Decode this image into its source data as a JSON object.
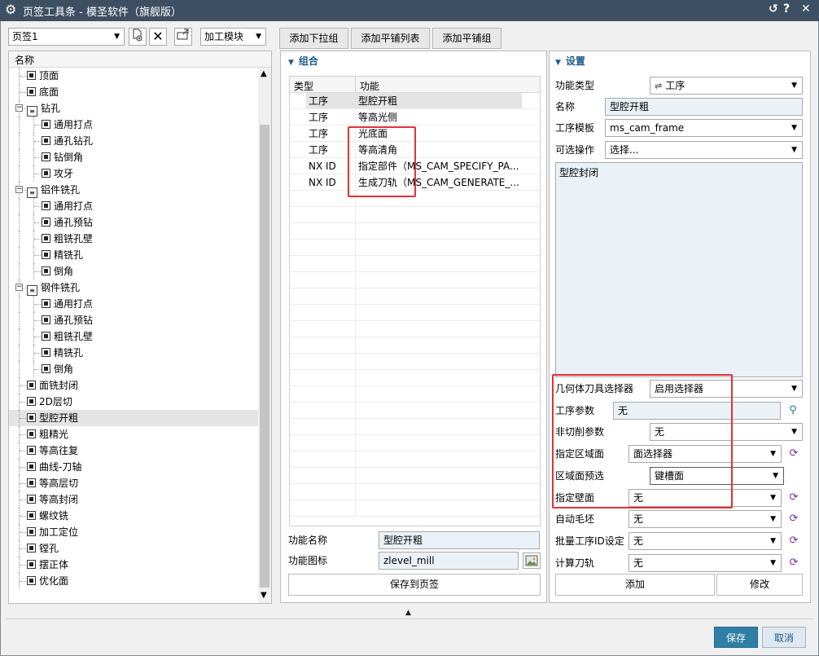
{
  "window": {
    "title": "页签工具条 - 模圣软件（旗舰版）",
    "reset_glyph": "↺",
    "help_glyph": "?",
    "close_glyph": "✕"
  },
  "left": {
    "page_select": "页签1",
    "module_select": "加工模块",
    "column_header": "名称",
    "tree": [
      {
        "label": "顶面",
        "level": 1,
        "type": "leaf"
      },
      {
        "label": "底面",
        "level": 1,
        "type": "leaf"
      },
      {
        "label": "钻孔",
        "level": 1,
        "type": "group"
      },
      {
        "label": "通用打点",
        "level": 2,
        "type": "leaf"
      },
      {
        "label": "通孔钻孔",
        "level": 2,
        "type": "leaf"
      },
      {
        "label": "钻倒角",
        "level": 2,
        "type": "leaf"
      },
      {
        "label": "攻牙",
        "level": 2,
        "type": "leaf"
      },
      {
        "label": "铝件铣孔",
        "level": 1,
        "type": "group"
      },
      {
        "label": "通用打点",
        "level": 2,
        "type": "leaf"
      },
      {
        "label": "通孔预钻",
        "level": 2,
        "type": "leaf"
      },
      {
        "label": "粗铣孔壁",
        "level": 2,
        "type": "leaf"
      },
      {
        "label": "精铣孔",
        "level": 2,
        "type": "leaf"
      },
      {
        "label": "倒角",
        "level": 2,
        "type": "leaf"
      },
      {
        "label": "钢件铣孔",
        "level": 1,
        "type": "group"
      },
      {
        "label": "通用打点",
        "level": 2,
        "type": "leaf"
      },
      {
        "label": "通孔预钻",
        "level": 2,
        "type": "leaf"
      },
      {
        "label": "粗铣孔壁",
        "level": 2,
        "type": "leaf"
      },
      {
        "label": "精铣孔",
        "level": 2,
        "type": "leaf"
      },
      {
        "label": "倒角",
        "level": 2,
        "type": "leaf"
      },
      {
        "label": "面铣封闭",
        "level": 1,
        "type": "leaf"
      },
      {
        "label": "2D层切",
        "level": 1,
        "type": "leaf"
      },
      {
        "label": "型腔开粗",
        "level": 1,
        "type": "leaf",
        "selected": true
      },
      {
        "label": "粗精光",
        "level": 1,
        "type": "leaf"
      },
      {
        "label": "等高往复",
        "level": 1,
        "type": "leaf"
      },
      {
        "label": "曲线-刀轴",
        "level": 1,
        "type": "leaf"
      },
      {
        "label": "等高层切",
        "level": 1,
        "type": "leaf"
      },
      {
        "label": "等高封闭",
        "level": 1,
        "type": "leaf"
      },
      {
        "label": "螺纹铣",
        "level": 1,
        "type": "leaf"
      },
      {
        "label": "加工定位",
        "level": 1,
        "type": "leaf"
      },
      {
        "label": "镗孔",
        "level": 1,
        "type": "leaf"
      },
      {
        "label": "摆正体",
        "level": 1,
        "type": "leaf"
      },
      {
        "label": "优化面",
        "level": 1,
        "type": "leaf"
      }
    ]
  },
  "tabs": [
    "添加下拉组",
    "添加平铺列表",
    "添加平铺组"
  ],
  "middle": {
    "section_title": "组合",
    "col_type": "类型",
    "col_function": "功能",
    "rows": [
      {
        "type": "工序",
        "function": "型腔开粗",
        "selected": true
      },
      {
        "type": "工序",
        "function": "等高光侧"
      },
      {
        "type": "工序",
        "function": "光底面"
      },
      {
        "type": "工序",
        "function": "等高清角"
      },
      {
        "type": "NX ID",
        "function": "指定部件（MS_CAM_SPECIFY_PA..."
      },
      {
        "type": "NX ID",
        "function": "生成刀轨（MS_CAM_GENERATE_..."
      }
    ],
    "func_name_label": "功能名称",
    "func_name_value": "型腔开粗",
    "func_icon_label": "功能图标",
    "func_icon_value": "zlevel_mill",
    "save_button": "保存到页签"
  },
  "right": {
    "section_title": "设置",
    "func_type_label": "功能类型",
    "func_type_value": "工序",
    "name_label": "名称",
    "name_value": "型腔开粗",
    "template_label": "工序模板",
    "template_value": "ms_cam_frame",
    "optional_label": "可选操作",
    "optional_value": "选择...",
    "text_area": "型腔封闭",
    "params": [
      {
        "label": "几何体刀具选择器",
        "value": "启用选择器",
        "kind": "select"
      },
      {
        "label": "工序参数",
        "value": "无",
        "kind": "search"
      },
      {
        "label": "非切削参数",
        "value": "无",
        "kind": "select"
      },
      {
        "label": "指定区域面",
        "value": "面选择器",
        "kind": "select-refresh"
      },
      {
        "label": "区域面预选",
        "value": "键槽面",
        "kind": "select-refresh-focus"
      },
      {
        "label": "指定壁面",
        "value": "无",
        "kind": "select-refresh"
      },
      {
        "label": "自动毛坯",
        "value": "无",
        "kind": "select-refresh"
      },
      {
        "label": "批量工序ID设定",
        "value": "无",
        "kind": "select-refresh"
      },
      {
        "label": "计算刀轨",
        "value": "无",
        "kind": "select-refresh"
      }
    ],
    "add_button": "添加",
    "modify_button": "修改"
  },
  "footer": {
    "save": "保存",
    "cancel": "取消"
  },
  "colors": {
    "titlebar": "#3c4f63",
    "accent": "#1e5a8a",
    "primary_button": "#2f7ea4",
    "highlight_box": "#e0323a",
    "selected_row": "#e4e4e4"
  }
}
